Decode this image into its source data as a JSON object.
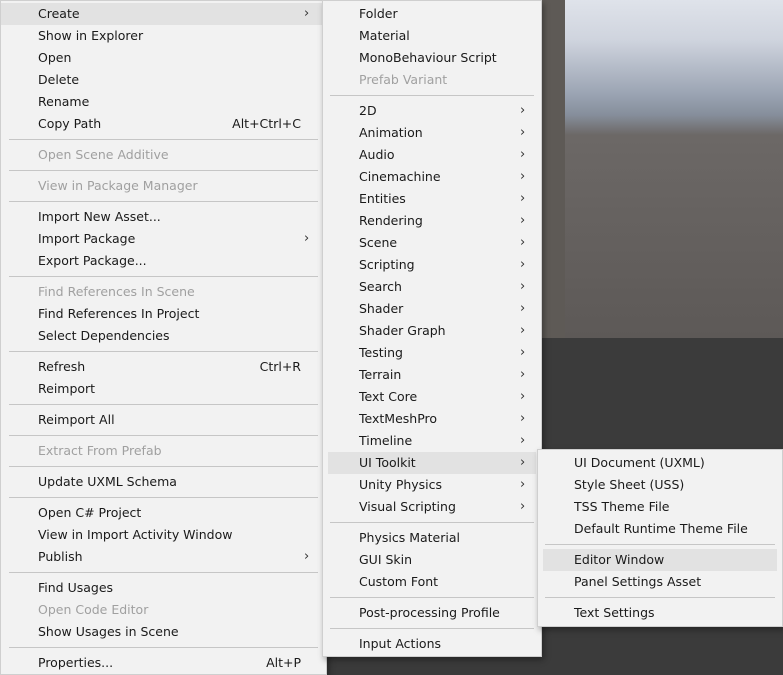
{
  "main_menu": [
    {
      "label": "Create",
      "submenu": true
    },
    {
      "label": "Show in Explorer"
    },
    {
      "label": "Open"
    },
    {
      "label": "Delete"
    },
    {
      "label": "Rename"
    },
    {
      "label": "Copy Path",
      "shortcut": "Alt+Ctrl+C"
    },
    {
      "label": "Open Scene Additive",
      "disabled": true
    },
    {
      "label": "View in Package Manager",
      "disabled": true
    },
    {
      "label": "Import New Asset..."
    },
    {
      "label": "Import Package",
      "submenu": true
    },
    {
      "label": "Export Package..."
    },
    {
      "label": "Find References In Scene",
      "disabled": true
    },
    {
      "label": "Find References In Project"
    },
    {
      "label": "Select Dependencies"
    },
    {
      "label": "Refresh",
      "shortcut": "Ctrl+R"
    },
    {
      "label": "Reimport"
    },
    {
      "label": "Reimport All"
    },
    {
      "label": "Extract From Prefab",
      "disabled": true
    },
    {
      "label": "Update UXML Schema"
    },
    {
      "label": "Open C# Project"
    },
    {
      "label": "View in Import Activity Window"
    },
    {
      "label": "Publish",
      "submenu": true
    },
    {
      "label": "Find Usages"
    },
    {
      "label": "Open Code Editor",
      "disabled": true
    },
    {
      "label": "Show Usages in Scene"
    },
    {
      "label": "Properties...",
      "shortcut": "Alt+P"
    }
  ],
  "create_menu": [
    {
      "label": "Folder"
    },
    {
      "label": "Material"
    },
    {
      "label": "MonoBehaviour Script"
    },
    {
      "label": "Prefab Variant",
      "disabled": true
    },
    {
      "label": "2D",
      "submenu": true
    },
    {
      "label": "Animation",
      "submenu": true
    },
    {
      "label": "Audio",
      "submenu": true
    },
    {
      "label": "Cinemachine",
      "submenu": true
    },
    {
      "label": "Entities",
      "submenu": true
    },
    {
      "label": "Rendering",
      "submenu": true
    },
    {
      "label": "Scene",
      "submenu": true
    },
    {
      "label": "Scripting",
      "submenu": true
    },
    {
      "label": "Search",
      "submenu": true
    },
    {
      "label": "Shader",
      "submenu": true
    },
    {
      "label": "Shader Graph",
      "submenu": true
    },
    {
      "label": "Testing",
      "submenu": true
    },
    {
      "label": "Terrain",
      "submenu": true
    },
    {
      "label": "Text Core",
      "submenu": true
    },
    {
      "label": "TextMeshPro",
      "submenu": true
    },
    {
      "label": "Timeline",
      "submenu": true
    },
    {
      "label": "UI Toolkit",
      "submenu": true
    },
    {
      "label": "Unity Physics",
      "submenu": true
    },
    {
      "label": "Visual Scripting",
      "submenu": true
    },
    {
      "label": "Physics Material"
    },
    {
      "label": "GUI Skin"
    },
    {
      "label": "Custom Font"
    },
    {
      "label": "Post-processing Profile"
    },
    {
      "label": "Input Actions"
    }
  ],
  "uitoolkit_menu": [
    {
      "label": "UI Document (UXML)"
    },
    {
      "label": "Style Sheet (USS)"
    },
    {
      "label": "TSS Theme File"
    },
    {
      "label": "Default Runtime Theme File"
    },
    {
      "label": "Editor Window"
    },
    {
      "label": "Panel Settings Asset"
    },
    {
      "label": "Text Settings"
    }
  ],
  "icons": {
    "submenu_arrow": "chevron-right-icon",
    "glyph": "›"
  }
}
